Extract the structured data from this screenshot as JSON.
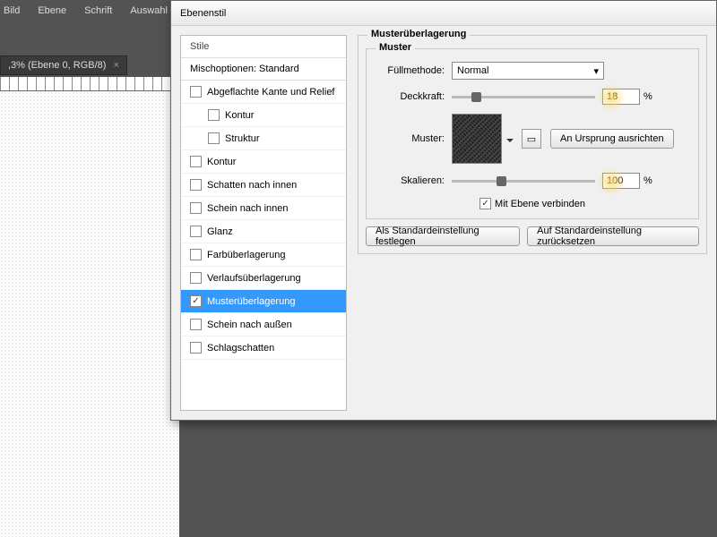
{
  "menu": {
    "bild": "Bild",
    "ebene": "Ebene",
    "schrift": "Schrift",
    "auswahl": "Auswahl"
  },
  "doc_tab": ",3% (Ebene 0, RGB/8)",
  "dialog": {
    "title": "Ebenenstil",
    "styles_header": "Stile",
    "blend_label": "Mischoptionen: Standard",
    "items": [
      {
        "label": "Abgeflachte Kante und Relief",
        "indent": false,
        "checked": false,
        "selected": false
      },
      {
        "label": "Kontur",
        "indent": true,
        "checked": false,
        "selected": false
      },
      {
        "label": "Struktur",
        "indent": true,
        "checked": false,
        "selected": false
      },
      {
        "label": "Kontur",
        "indent": false,
        "checked": false,
        "selected": false
      },
      {
        "label": "Schatten nach innen",
        "indent": false,
        "checked": false,
        "selected": false
      },
      {
        "label": "Schein nach innen",
        "indent": false,
        "checked": false,
        "selected": false
      },
      {
        "label": "Glanz",
        "indent": false,
        "checked": false,
        "selected": false
      },
      {
        "label": "Farbüberlagerung",
        "indent": false,
        "checked": false,
        "selected": false
      },
      {
        "label": "Verlaufsüberlagerung",
        "indent": false,
        "checked": false,
        "selected": false
      },
      {
        "label": "Musterüberlagerung",
        "indent": false,
        "checked": true,
        "selected": true
      },
      {
        "label": "Schein nach außen",
        "indent": false,
        "checked": false,
        "selected": false
      },
      {
        "label": "Schlagschatten",
        "indent": false,
        "checked": false,
        "selected": false
      }
    ]
  },
  "panel": {
    "group_title": "Musterüberlagerung",
    "subgroup": "Muster",
    "blendmode_label": "Füllmethode:",
    "blendmode_value": "Normal",
    "opacity_label": "Deckkraft:",
    "opacity_value": "18",
    "percent": "%",
    "pattern_label": "Muster:",
    "snap_btn": "An Ursprung ausrichten",
    "scale_label": "Skalieren:",
    "scale_value": "100",
    "link_label": "Mit Ebene verbinden",
    "default_btn": "Als Standardeinstellung festlegen",
    "reset_btn": "Auf Standardeinstellung zurücksetzen"
  }
}
